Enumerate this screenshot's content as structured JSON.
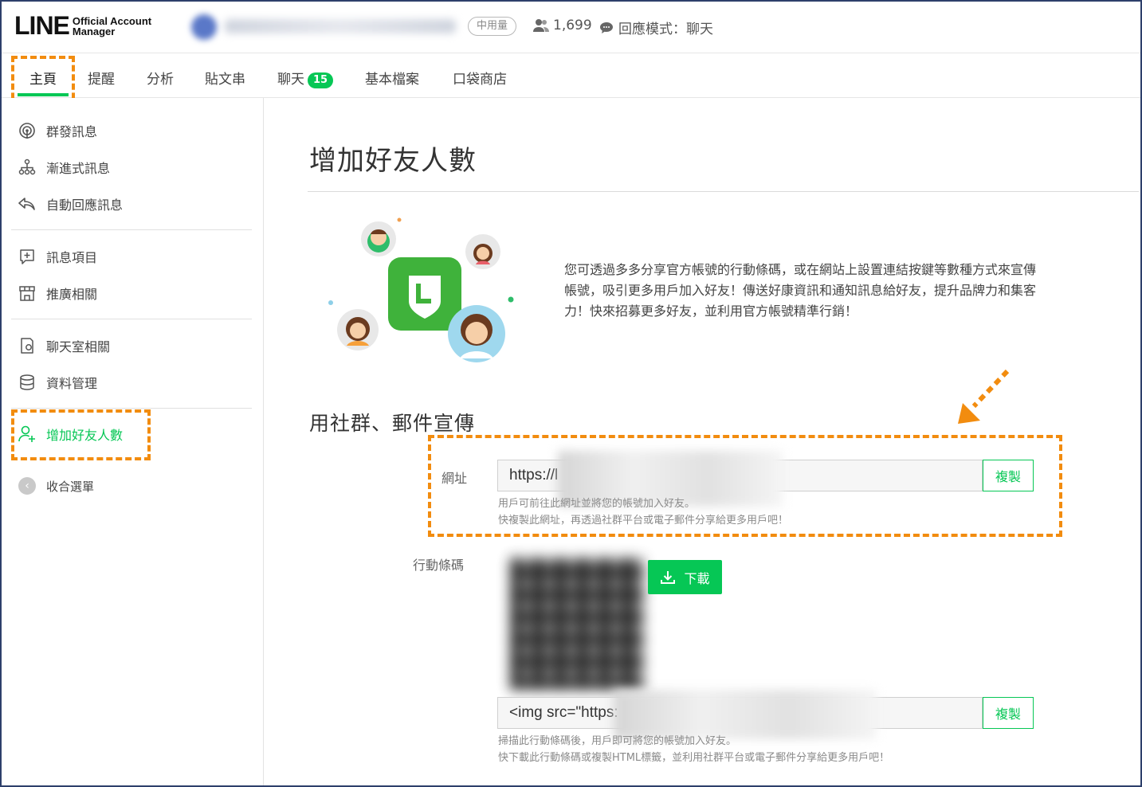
{
  "header": {
    "logo_main": "LINE",
    "logo_sub_1": "Official Account",
    "logo_sub_2": "Manager",
    "plan_badge": "中用量",
    "friend_count": "1,699",
    "response_mode": "回應模式：聊天"
  },
  "tabs": [
    {
      "label": "主頁"
    },
    {
      "label": "提醒"
    },
    {
      "label": "分析"
    },
    {
      "label": "貼文串"
    },
    {
      "label": "聊天",
      "badge": "15"
    },
    {
      "label": "基本檔案"
    },
    {
      "label": "口袋商店"
    }
  ],
  "sidebar": {
    "items": [
      {
        "label": "群發訊息",
        "icon": "broadcast-icon"
      },
      {
        "label": "漸進式訊息",
        "icon": "hierarchy-icon"
      },
      {
        "label": "自動回應訊息",
        "icon": "reply-icon"
      },
      {
        "label": "訊息項目",
        "icon": "add-box-icon"
      },
      {
        "label": "推廣相關",
        "icon": "shop-icon"
      },
      {
        "label": "聊天室相關",
        "icon": "chat-settings-icon"
      },
      {
        "label": "資料管理",
        "icon": "database-icon"
      },
      {
        "label": "增加好友人數",
        "icon": "add-friend-icon"
      },
      {
        "label": "收合選單",
        "icon": "collapse-icon"
      }
    ]
  },
  "main": {
    "title": "增加好友人數",
    "description": "您可透過多多分享官方帳號的行動條碼，或在網站上設置連結按鍵等數種方式來宣傳帳號，吸引更多用戶加入好友！傳送好康資訊和通知訊息給好友，提升品牌力和集客力！快來招募更多好友，並利用官方帳號精準行銷！",
    "section_title": "用社群、郵件宣傳",
    "url_label": "網址",
    "url_value": "https://l",
    "copy_label": "複製",
    "url_hint_1": "用戶可前往此網址並將您的帳號加入好友。",
    "url_hint_2": "快複製此網址，再透過社群平台或電子郵件分享給更多用戶吧！",
    "qr_label": "行動條碼",
    "download_label": "下載",
    "html_value": "<img src=\"https:",
    "qr_hint_1": "掃描此行動條碼後，用戶即可將您的帳號加入好友。",
    "qr_hint_2": "快下載此行動條碼或複製HTML標籤，並利用社群平台或電子郵件分享給更多用戶吧！"
  },
  "colors": {
    "brand_green": "#06c755",
    "highlight_orange": "#f28c0f",
    "frame_navy": "#2d3f6b"
  }
}
